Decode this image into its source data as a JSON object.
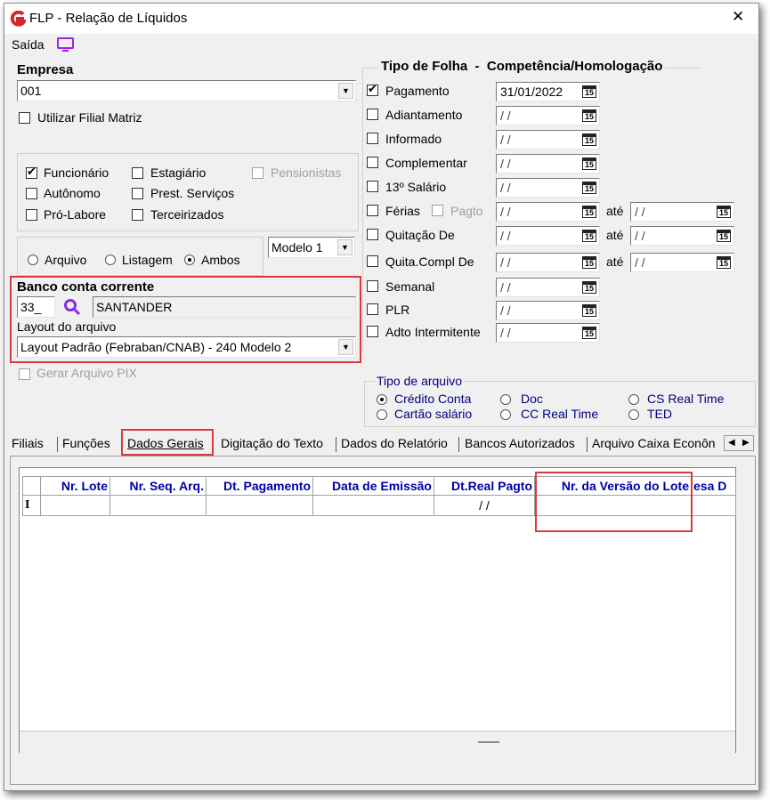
{
  "window": {
    "title": "FLP - Relação de Líquidos",
    "close_glyph": "✕"
  },
  "toolbar": {
    "saida_label": "Saída"
  },
  "empresa": {
    "label": "Empresa",
    "value": "001",
    "filial_matriz": "Utilizar Filial Matriz"
  },
  "categorias": {
    "funcionario": "Funcionário",
    "estagiario": "Estagiário",
    "pensionistas": "Pensionistas",
    "autonomo": "Autônomo",
    "prest_servicos": "Prest. Serviços",
    "pro_labore": "Pró-Labore",
    "terceirizados": "Terceirizados"
  },
  "saida_tipo": {
    "arquivo": "Arquivo",
    "listagem": "Listagem",
    "ambos": "Ambos",
    "modelo": "Modelo 1"
  },
  "banco": {
    "label": "Banco conta corrente",
    "codigo": "33_",
    "nome": "SANTANDER",
    "layout_label": "Layout do arquivo",
    "layout_value": "Layout Padrão (Febraban/CNAB) - 240 Modelo 2"
  },
  "gerar_pix": "Gerar Arquivo PIX",
  "tipo_folha": {
    "title": "Tipo de Folha  -  Competência/Homologação",
    "ate": "até",
    "pagto": "Pagto",
    "empty_date": "/ /",
    "rows": [
      {
        "label": "Pagamento",
        "date": "31/01/2022",
        "checked": true
      },
      {
        "label": "Adiantamento",
        "date": "/ /"
      },
      {
        "label": "Informado",
        "date": "/ /"
      },
      {
        "label": "Complementar",
        "date": "/ /"
      },
      {
        "label": "13º Salário",
        "date": "/ /"
      },
      {
        "label": "Férias",
        "date": "/ /"
      },
      {
        "label": "Quitação De",
        "date": "/ /"
      },
      {
        "label": "Quita.Compl De",
        "date": "/ /"
      },
      {
        "label": "Semanal",
        "date": "/ /"
      },
      {
        "label": "PLR",
        "date": "/ /"
      },
      {
        "label": "Adto Intermitente",
        "date": "/ /"
      }
    ]
  },
  "tipo_arquivo": {
    "title": "Tipo de arquivo",
    "credito_conta": "Crédito Conta",
    "doc": "Doc",
    "cs_real_time": "CS Real Time",
    "cartao_salario": "Cartão salário",
    "cc_real_time": "CC Real Time",
    "ted": "TED"
  },
  "tabs": [
    "Filiais",
    "Funções",
    "Dados Gerais",
    "Digitação do Texto",
    "Dados do Relatório",
    "Bancos Autorizados",
    "Arquivo Caixa Econôn"
  ],
  "grid": {
    "columns": [
      "Nr. Lote",
      "Nr. Seq. Arq.",
      "Dt. Pagamento",
      "Data de Emissão",
      "Dt.Real Pagto",
      "Nr. da Versão do Lote",
      "esa D"
    ],
    "row_indicator": "I",
    "row": [
      "",
      "",
      "",
      "",
      "/ /",
      "",
      ""
    ]
  },
  "calendar_icon": "15",
  "colors": {
    "accent_red": "#d83b3b",
    "grid_header": "#0000a8",
    "search_icon": "#8a2be2",
    "monitor_icon": "#a020f0"
  }
}
